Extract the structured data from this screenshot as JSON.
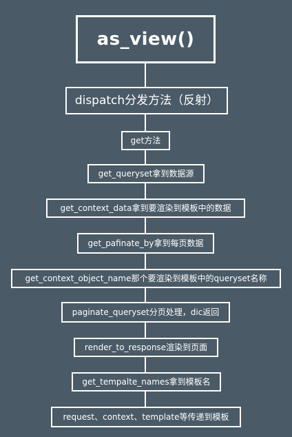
{
  "diagram": {
    "nodes": [
      "as_view()",
      "dispatch分发方法（反射）",
      "get方法",
      "get_queryset拿到数据源",
      "get_context_data拿到要渲染到模板中的数据",
      "get_pafinate_by拿到每页数据",
      "get_context_object_name那个要渲染到模板中的queryset名称",
      "paginate_queryset分页处理，dic返回",
      "render_to_response渲染到页面",
      "get_tempalte_names拿到模板名",
      "request、context、template等传递到模板"
    ],
    "colors": {
      "background": "#4a5a66",
      "stroke": "#ffffff",
      "text": "#ffffff"
    }
  }
}
